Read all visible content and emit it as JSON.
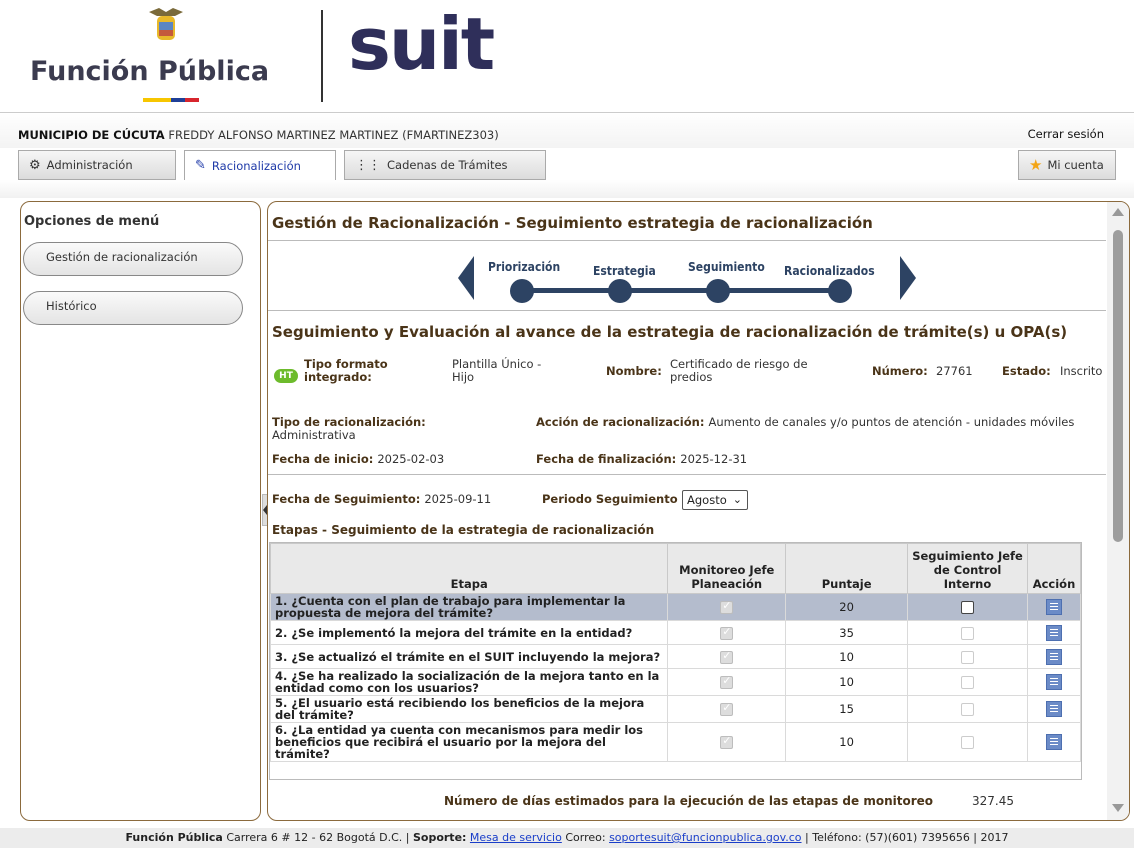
{
  "header": {
    "brand_left": "Función Pública",
    "brand_right": "suit",
    "flag_colors": [
      "#f7c600",
      "#1f3f97",
      "#d7252d"
    ]
  },
  "user_bar": {
    "entity": "MUNICIPIO DE CÚCUTA",
    "user": "FREDDY ALFONSO MARTINEZ MARTINEZ (FMARTINEZ303)",
    "logout": "Cerrar sesión"
  },
  "tabs": [
    {
      "label": "Administración",
      "icon": "admin-icon"
    },
    {
      "label": "Racionalización",
      "icon": "edit-icon",
      "active": true
    },
    {
      "label": "Cadenas de Trámites",
      "icon": "chain-icon"
    }
  ],
  "account_tab": {
    "label": "Mi cuenta",
    "icon": "star-icon"
  },
  "left_menu": {
    "title": "Opciones de menú",
    "items": [
      "Gestión de racionalización",
      "Histórico"
    ]
  },
  "main": {
    "title": "Gestión de Racionalización - Seguimiento estrategia de racionalización",
    "steps": [
      "Priorización",
      "Estrategia",
      "Seguimiento",
      "Racionalizados"
    ],
    "subtitle": "Seguimiento y Evaluación al avance de la estrategia de racionalización de trámite(s) u OPA(s)",
    "badge": "HT",
    "fields": {
      "tipo_formato_label": "Tipo formato integrado:",
      "tipo_formato_value": "Plantilla Único - Hijo",
      "nombre_label": "Nombre:",
      "nombre_value": "Certificado de riesgo de predios",
      "numero_label": "Número:",
      "numero_value": "27761",
      "estado_label": "Estado:",
      "estado_value": "Inscrito",
      "tipo_racionalizacion_label": "Tipo de racionalización:",
      "tipo_racionalizacion_value": "Administrativa",
      "accion_label": "Acción de racionalización:",
      "accion_value": "Aumento de canales y/o puntos de atención - unidades móviles",
      "fecha_inicio_label": "Fecha de inicio:",
      "fecha_inicio_value": "2025-02-03",
      "fecha_fin_label": "Fecha de finalización:",
      "fecha_fin_value": "2025-12-31",
      "fecha_seguimiento_label": "Fecha de Seguimiento:",
      "fecha_seguimiento_value": "2025-09-11",
      "periodo_label": "Periodo Seguimiento",
      "periodo_value": "Agosto"
    },
    "etapas_title": "Etapas - Seguimiento de la estrategia de racionalización",
    "table": {
      "headers": [
        "Etapa",
        "Monitoreo Jefe Planeación",
        "Puntaje",
        "Seguimiento Jefe de Control Interno",
        "Acción"
      ],
      "rows": [
        {
          "etapa": "1. ¿Cuenta con el plan de trabajo para implementar la propuesta de mejora del trámite?",
          "monitoreo": true,
          "puntaje": "20",
          "seguimiento": false,
          "selected": true
        },
        {
          "etapa": "2. ¿Se implementó la mejora del trámite en la entidad?",
          "monitoreo": true,
          "puntaje": "35",
          "seguimiento": false
        },
        {
          "etapa": "3. ¿Se actualizó el trámite en el SUIT incluyendo la mejora?",
          "monitoreo": true,
          "puntaje": "10",
          "seguimiento": false
        },
        {
          "etapa": "4. ¿Se ha realizado la socialización de la mejora tanto en la entidad como con los usuarios?",
          "monitoreo": true,
          "puntaje": "10",
          "seguimiento": false
        },
        {
          "etapa": "5. ¿El usuario está recibiendo los beneficios de la mejora del trámite?",
          "monitoreo": true,
          "puntaje": "15",
          "seguimiento": false
        },
        {
          "etapa": "6. ¿La entidad ya cuenta con mecanismos para medir los beneficios que recibirá el usuario por la mejora del trámite?",
          "monitoreo": true,
          "puntaje": "10",
          "seguimiento": false
        }
      ]
    },
    "dias_label": "Número de días estimados para la ejecución de las etapas de monitoreo",
    "dias_value": "327.45"
  },
  "footer": {
    "org": "Función Pública",
    "address": "Carrera 6 # 12 - 62 Bogotá D.C. |",
    "soporte_label": "Soporte:",
    "mesa": "Mesa de servicio",
    "correo_label": "Correo:",
    "correo": "soportesuit@funcionpublica.gov.co",
    "rest": "| Teléfono: (57)(601) 7395656 | 2017"
  }
}
